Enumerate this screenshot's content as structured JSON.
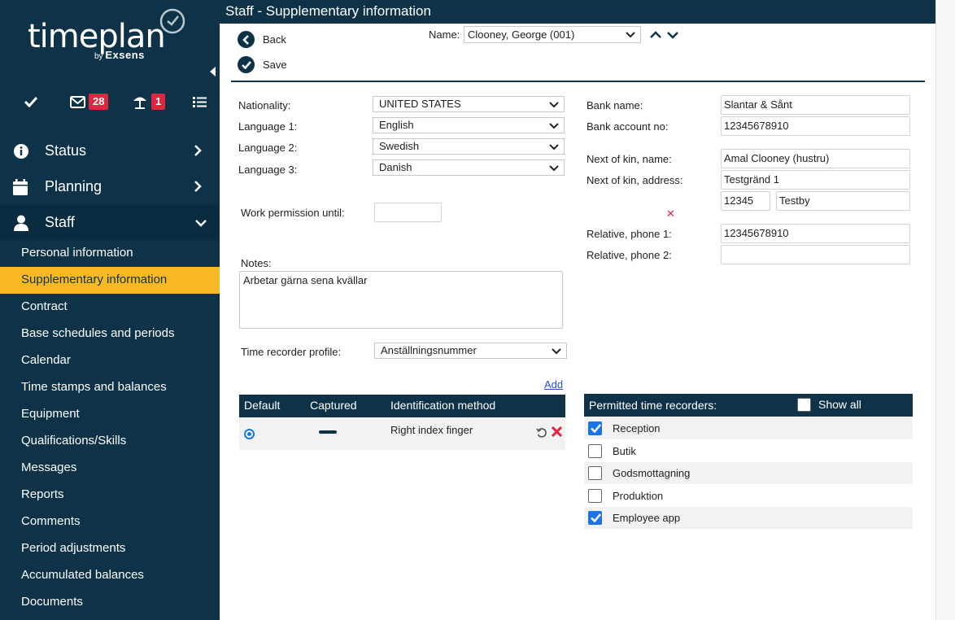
{
  "brand": {
    "name": "timeplan",
    "by": "by",
    "vendor": "Exsens"
  },
  "quickbar": {
    "messages_count": "28",
    "absence_count": "1"
  },
  "nav": {
    "sections": [
      {
        "label": "Status"
      },
      {
        "label": "Planning"
      },
      {
        "label": "Staff"
      }
    ],
    "staff_items": [
      "Personal information",
      "Supplementary information",
      "Contract",
      "Base schedules and periods",
      "Calendar",
      "Time stamps and balances",
      "Equipment",
      "Qualifications/Skills",
      "Messages",
      "Reports",
      "Comments",
      "Period adjustments",
      "Accumulated balances",
      "Documents"
    ]
  },
  "page": {
    "title": "Staff - Supplementary information",
    "back_label": "Back",
    "save_label": "Save",
    "name_label": "Name:",
    "name_value": "Clooney, George (001)"
  },
  "form": {
    "nationality_label": "Nationality:",
    "nationality_value": "UNITED STATES",
    "language1_label": "Language 1:",
    "language1_value": "English",
    "language2_label": "Language 2:",
    "language2_value": "Swedish",
    "language3_label": "Language 3:",
    "language3_value": "Danish",
    "work_permission_label": "Work permission until:",
    "work_permission_value": "",
    "notes_label": "Notes:",
    "notes_value": "Arbetar gärna sena kvällar",
    "time_recorder_profile_label": "Time recorder profile:",
    "time_recorder_profile_value": "Anställningsnummer",
    "bank_name_label": "Bank name:",
    "bank_name_value": "Slantar & Sånt",
    "bank_account_label": "Bank account no:",
    "bank_account_value": "12345678910",
    "kin_name_label": "Next of kin, name:",
    "kin_name_value": "Amal Clooney (hustru)",
    "kin_address_label": "Next of kin, address:",
    "kin_address_value": "Testgränd 1",
    "kin_zip_value": "12345",
    "kin_city_value": "Testby",
    "relative_phone1_label": "Relative, phone 1:",
    "relative_phone1_value": "12345678910",
    "relative_phone2_label": "Relative, phone 2:",
    "relative_phone2_value": ""
  },
  "identification": {
    "add_label": "Add",
    "headers": [
      "Default",
      "Captured",
      "Identification method"
    ],
    "rows": [
      {
        "method": "Right index finger"
      }
    ]
  },
  "recorders": {
    "header": "Permitted time recorders:",
    "show_all_label": "Show all",
    "items": [
      {
        "label": "Reception",
        "checked": true
      },
      {
        "label": "Butik",
        "checked": false
      },
      {
        "label": "Godsmottagning",
        "checked": false
      },
      {
        "label": "Produktion",
        "checked": false
      },
      {
        "label": "Employee app",
        "checked": true
      }
    ]
  },
  "colors": {
    "navy": "#0e3349",
    "accent": "#f7b824",
    "badge": "#e0263f",
    "check": "#1a73e8"
  }
}
